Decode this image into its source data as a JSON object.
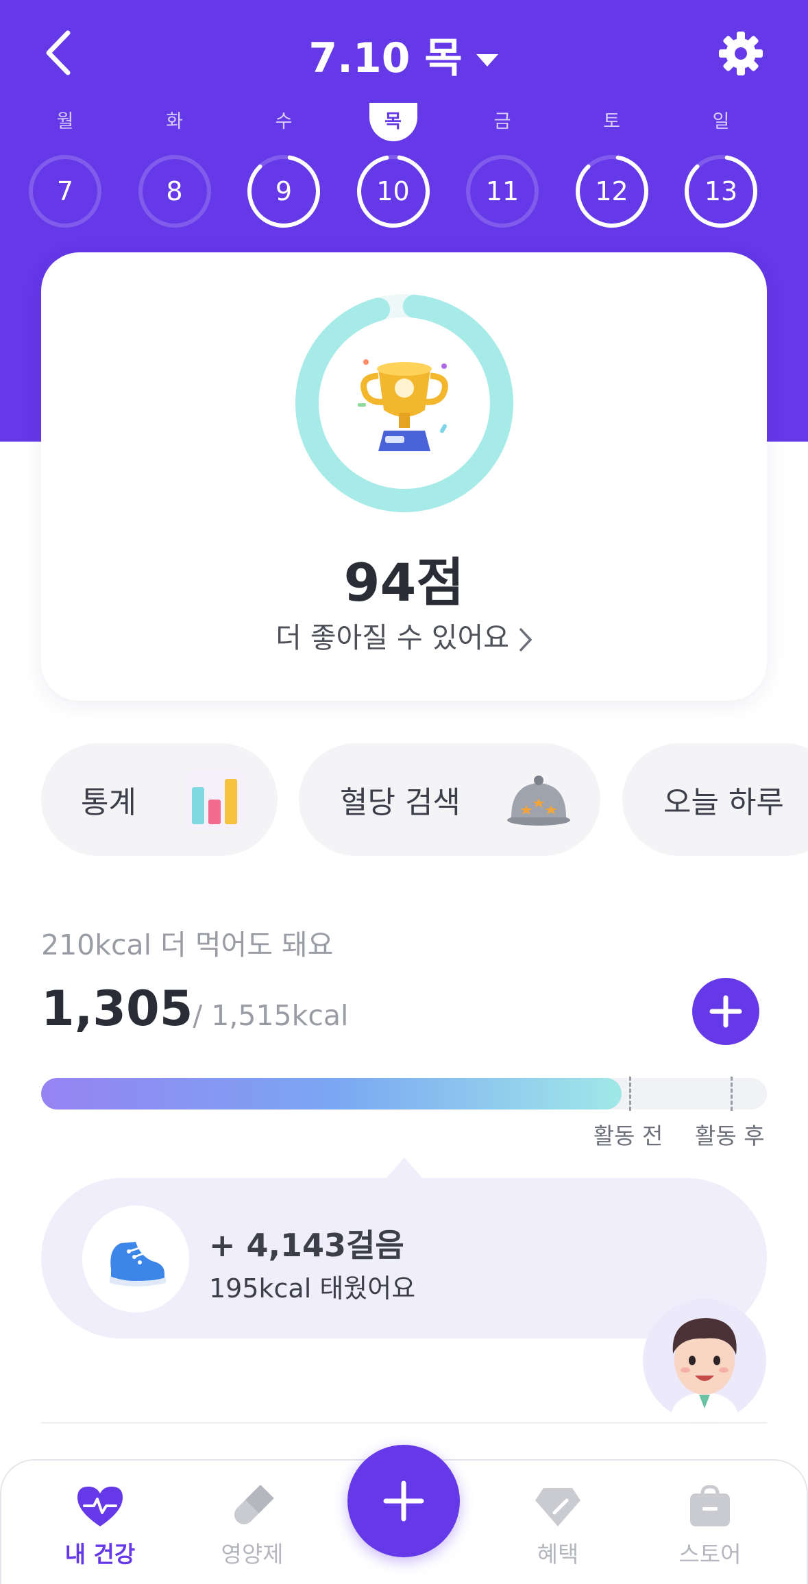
{
  "header": {
    "date_label": "7.10 목"
  },
  "week": [
    {
      "dow": "월",
      "date": "7",
      "progress": 0,
      "selected": false
    },
    {
      "dow": "화",
      "date": "8",
      "progress": 0,
      "selected": false
    },
    {
      "dow": "수",
      "date": "9",
      "progress": 0.85,
      "selected": false
    },
    {
      "dow": "목",
      "date": "10",
      "progress": 0.94,
      "selected": true
    },
    {
      "dow": "금",
      "date": "11",
      "progress": 0,
      "selected": false
    },
    {
      "dow": "토",
      "date": "12",
      "progress": 0.85,
      "selected": false
    },
    {
      "dow": "일",
      "date": "13",
      "progress": 0.85,
      "selected": false
    }
  ],
  "score": {
    "value": "94점",
    "message": "더 좋아질 수 있어요",
    "progress": 0.94,
    "ring_color": "#a6ebe8"
  },
  "chips": [
    {
      "label": "통계",
      "icon": "bar-chart-icon"
    },
    {
      "label": "혈당 검색",
      "icon": "cloche-icon"
    },
    {
      "label": "오늘 하루",
      "icon": ""
    }
  ],
  "calories": {
    "remaining_note": "210kcal 더 먹어도 돼요",
    "consumed": "1,305",
    "target": "/ 1,515kcal",
    "fill_ratio": 0.8,
    "markers": [
      {
        "label": "활동 전",
        "position": 0.81
      },
      {
        "label": "활동 후",
        "position": 0.95
      }
    ]
  },
  "steps": {
    "count": "+ 4,143걸음",
    "burned": "195kcal 태웠어요"
  },
  "nav": {
    "items": [
      {
        "label": "내 건강",
        "icon": "heart-pulse-icon",
        "active": true
      },
      {
        "label": "영양제",
        "icon": "pill-icon",
        "active": false
      },
      {
        "label": "혜택",
        "icon": "tag-icon",
        "active": false
      },
      {
        "label": "스토어",
        "icon": "shopping-bag-icon",
        "active": false
      }
    ]
  },
  "colors": {
    "brand": "#6538e8",
    "ring": "#a6ebe8"
  }
}
